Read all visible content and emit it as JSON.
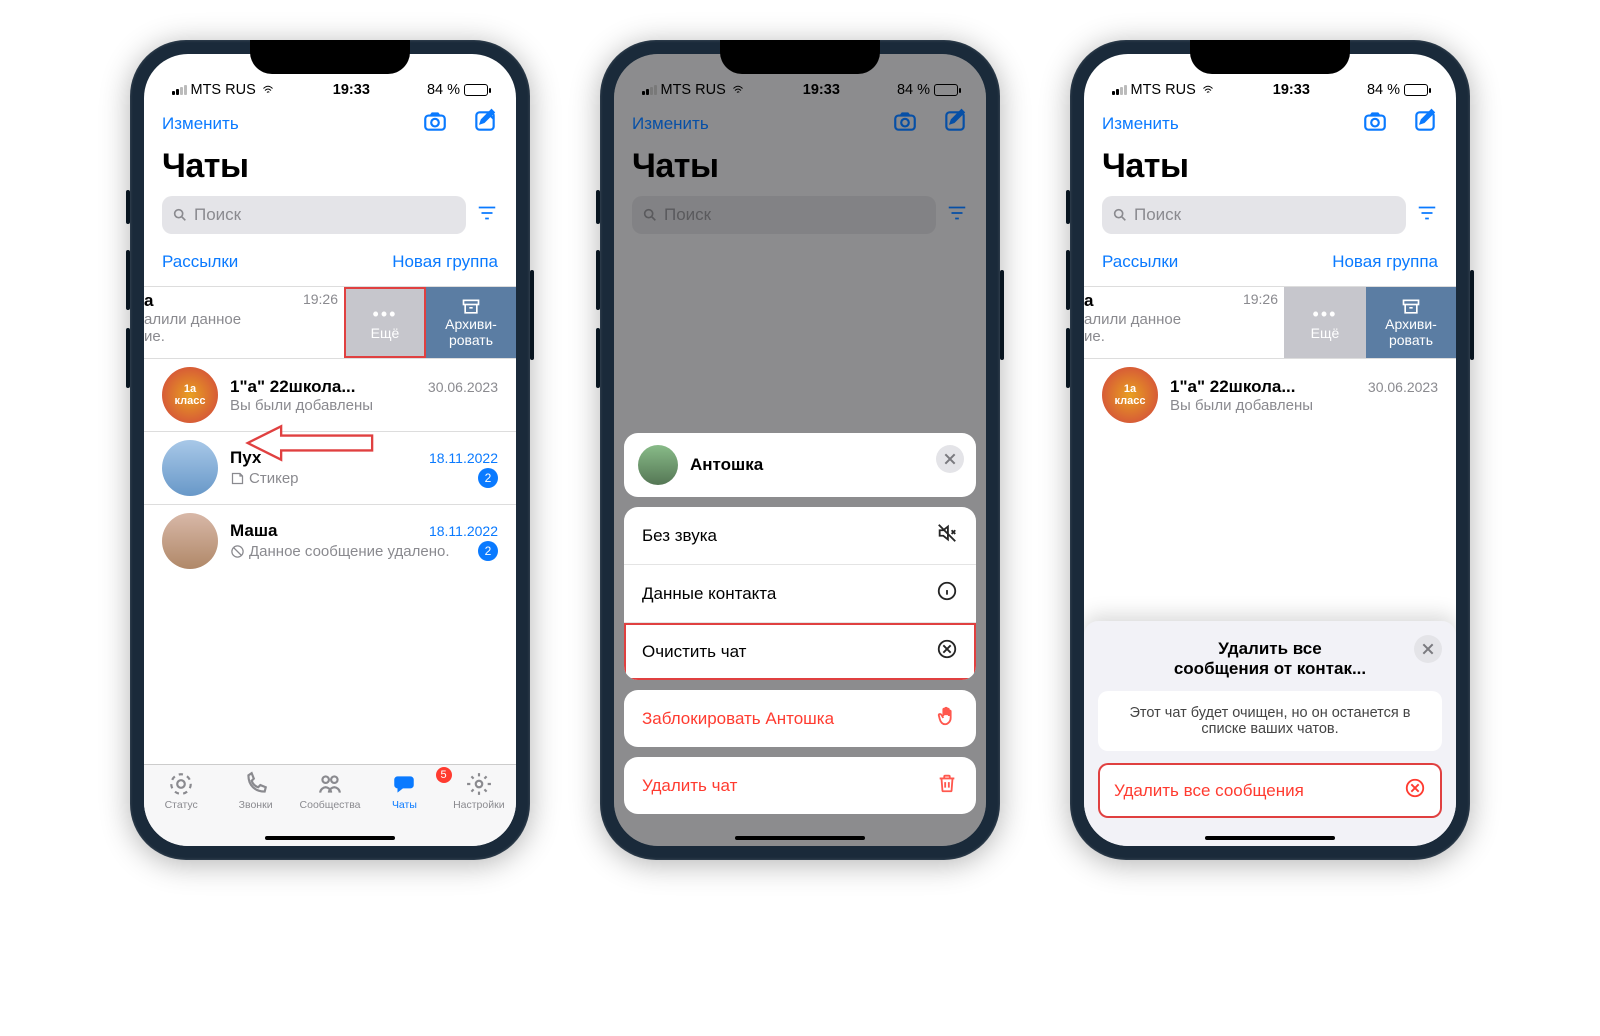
{
  "status": {
    "carrier": "MTS RUS",
    "time": "19:33",
    "battery": "84 %"
  },
  "nav": {
    "edit": "Изменить"
  },
  "title": "Чаты",
  "search": {
    "placeholder": "Поиск"
  },
  "sublinks": {
    "broadcasts": "Рассылки",
    "newgroup": "Новая группа"
  },
  "swiped": {
    "name_frag": "а",
    "time": "19:26",
    "sub1_frag": "алили данное",
    "sub2_frag": "ие.",
    "more": "Ещё",
    "archive": "Архиви-\nровать"
  },
  "chats": [
    {
      "name": "1\"а\" 22школа...",
      "date": "30.06.2023",
      "sub": "Вы были добавлены",
      "blue_date": false,
      "badge": null
    },
    {
      "name": "Пух",
      "date": "18.11.2022",
      "sub": "Стикер",
      "blue_date": true,
      "badge": "2",
      "sticker_icon": true
    },
    {
      "name": "Маша",
      "date": "18.11.2022",
      "sub": "Данное сообщение удалено.",
      "blue_date": true,
      "badge": "2",
      "deleted_icon": true
    }
  ],
  "tabs": {
    "status": "Статус",
    "calls": "Звонки",
    "communities": "Сообщества",
    "chats": "Чаты",
    "chats_badge": "5",
    "settings": "Настройки"
  },
  "sheet": {
    "contact": "Антошка",
    "mute": "Без звука",
    "info": "Данные контакта",
    "clear": "Очистить чат",
    "block": "Заблокировать Антошка",
    "delete": "Удалить чат"
  },
  "confirm": {
    "title_l1": "Удалить все",
    "title_l2": "сообщения от контак...",
    "desc": "Этот чат будет очищен, но он останется в списке ваших чатов.",
    "action": "Удалить все сообщения"
  }
}
